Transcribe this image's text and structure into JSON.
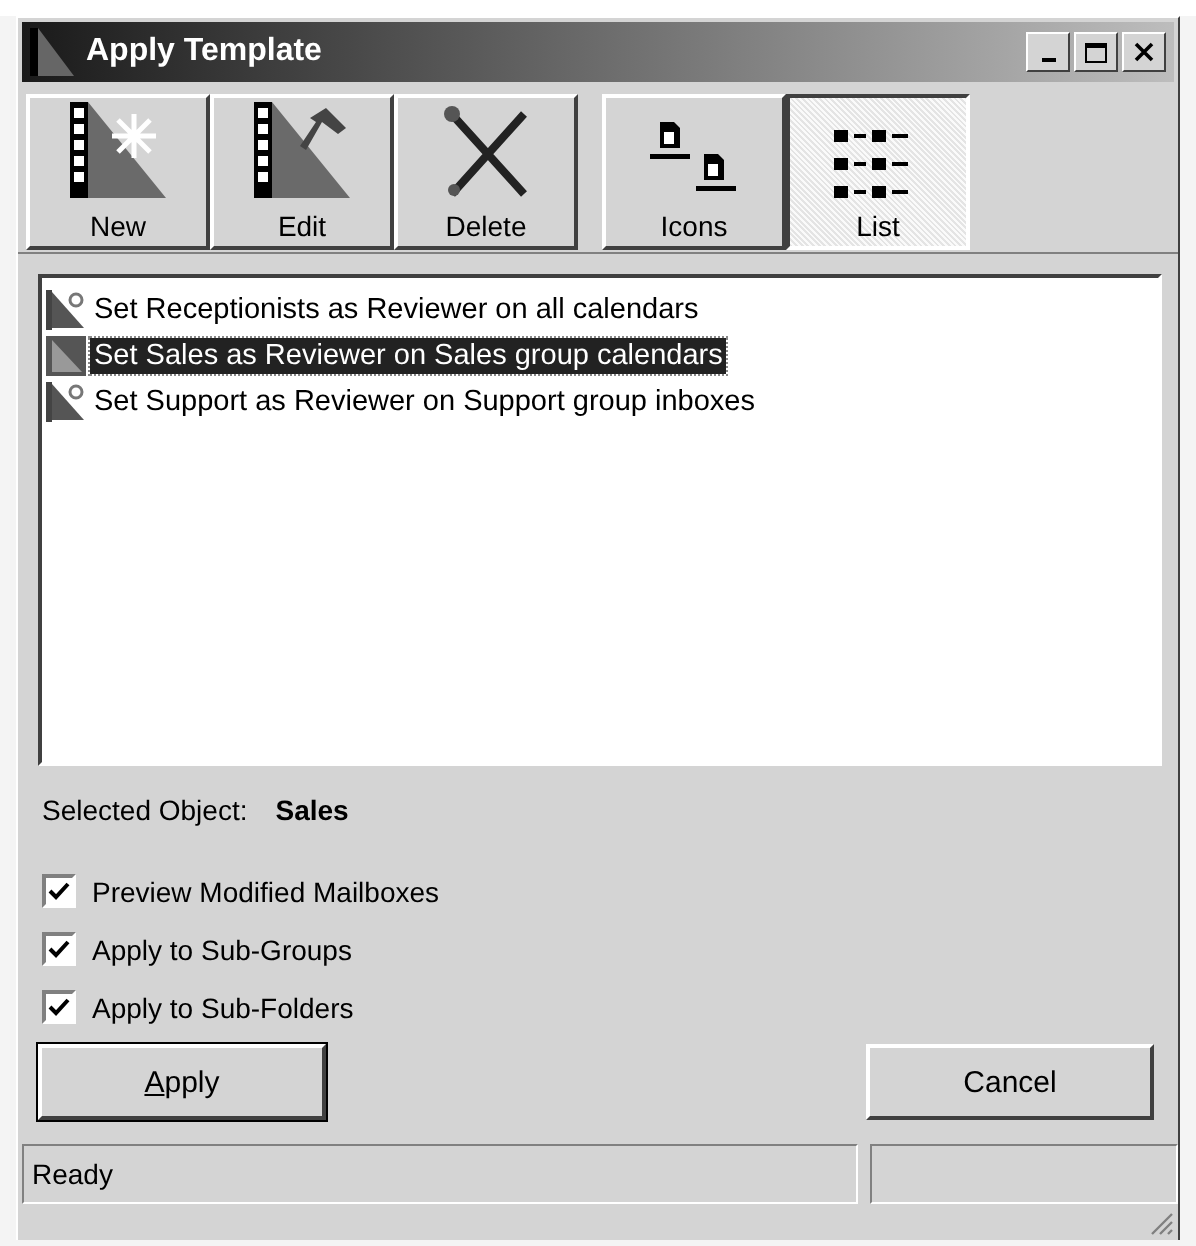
{
  "window": {
    "title": "Apply Template"
  },
  "toolbar": [
    {
      "label": "New",
      "kind": "new",
      "selected": false
    },
    {
      "label": "Edit",
      "kind": "edit",
      "selected": false
    },
    {
      "label": "Delete",
      "kind": "delete",
      "selected": false
    },
    {
      "label": "Icons",
      "kind": "icons",
      "selected": false
    },
    {
      "label": "List",
      "kind": "list",
      "selected": true
    }
  ],
  "templates": [
    {
      "label": "Set Receptionists as Reviewer on all calendars",
      "selected": false
    },
    {
      "label": "Set Sales as Reviewer on Sales group calendars",
      "selected": true
    },
    {
      "label": "Set Support as Reviewer on Support group inboxes",
      "selected": false
    }
  ],
  "selected_object": {
    "label": "Selected Object:",
    "value": "Sales"
  },
  "options": [
    {
      "label": "Preview Modified Mailboxes",
      "checked": true
    },
    {
      "label": "Apply to Sub-Groups",
      "checked": true
    },
    {
      "label": "Apply to Sub-Folders",
      "checked": true
    }
  ],
  "buttons": {
    "apply": "Apply",
    "cancel": "Cancel"
  },
  "status_bar": {
    "text": "Ready"
  }
}
